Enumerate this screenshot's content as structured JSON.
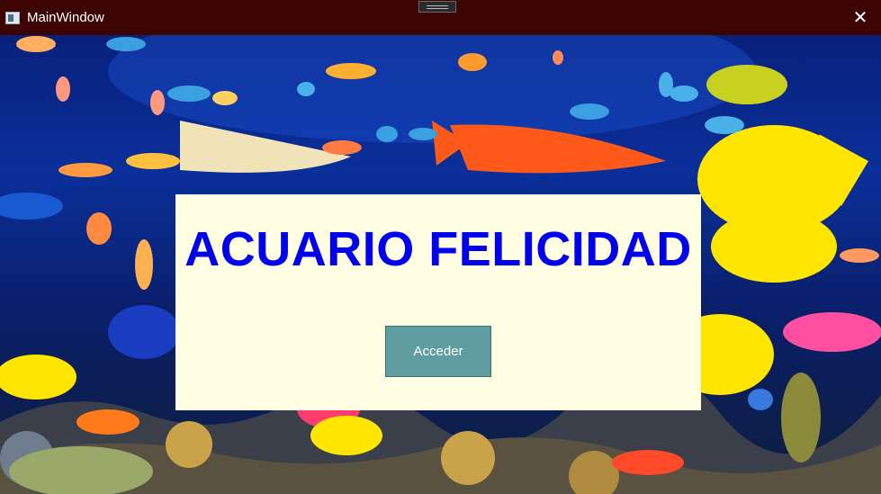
{
  "window": {
    "title": "MainWindow",
    "close_glyph": "✕"
  },
  "panel": {
    "heading": "ACUARIO FELICIDAD",
    "button_label": "Acceder"
  },
  "colors": {
    "titlebar": "#3d0404",
    "panel_bg": "#fffee3",
    "heading": "#0000ee",
    "button": "#5f9ea0"
  },
  "icons": {
    "app": "app-window-icon",
    "close": "close-icon",
    "grip": "drag-grip-icon"
  }
}
